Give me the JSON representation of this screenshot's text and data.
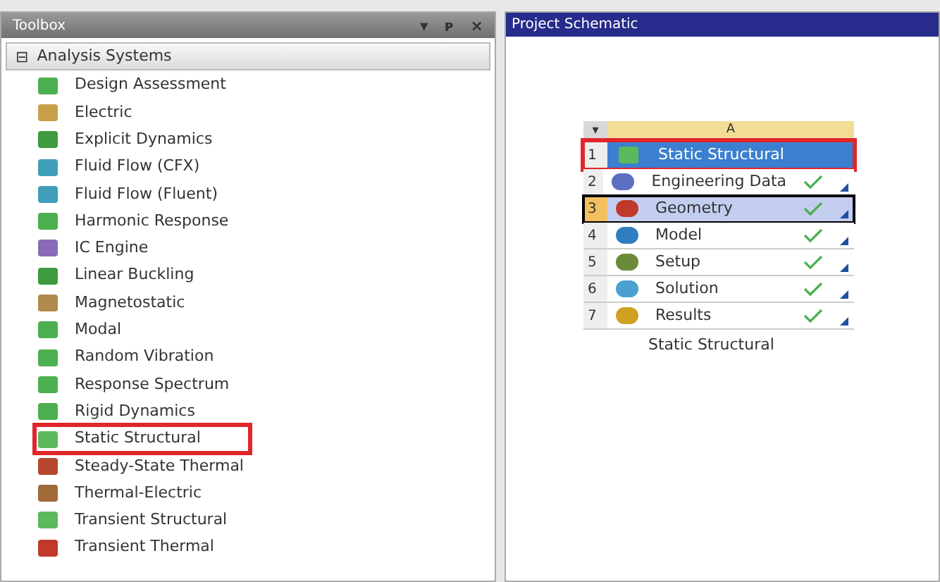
{
  "toolbox": {
    "title": "Toolbox",
    "controls": [
      "▾",
      "ᴘ",
      "×"
    ],
    "group": {
      "label": "Analysis Systems",
      "expanded": true,
      "toggle": "⊟"
    },
    "items": [
      {
        "label": "Design Assessment",
        "color": "#4caf50",
        "highlighted": false
      },
      {
        "label": "Electric",
        "color": "#c9a04a",
        "highlighted": false
      },
      {
        "label": "Explicit Dynamics",
        "color": "#3e9b3e",
        "highlighted": false
      },
      {
        "label": "Fluid Flow (CFX)",
        "color": "#3f9fb8",
        "highlighted": false
      },
      {
        "label": "Fluid Flow (Fluent)",
        "color": "#3f9fb8",
        "highlighted": false
      },
      {
        "label": "Harmonic Response",
        "color": "#4caf50",
        "highlighted": false
      },
      {
        "label": "IC Engine",
        "color": "#8a6bb8",
        "highlighted": false
      },
      {
        "label": "Linear Buckling",
        "color": "#3e9b3e",
        "highlighted": false
      },
      {
        "label": "Magnetostatic",
        "color": "#b08a4a",
        "highlighted": false
      },
      {
        "label": "Modal",
        "color": "#4caf50",
        "highlighted": false
      },
      {
        "label": "Random Vibration",
        "color": "#4caf50",
        "highlighted": false
      },
      {
        "label": "Response Spectrum",
        "color": "#4caf50",
        "highlighted": false
      },
      {
        "label": "Rigid Dynamics",
        "color": "#4caf50",
        "highlighted": false
      },
      {
        "label": "Static Structural",
        "color": "#5cb85c",
        "highlighted": true
      },
      {
        "label": "Steady-State Thermal",
        "color": "#b5482e",
        "highlighted": false
      },
      {
        "label": "Thermal-Electric",
        "color": "#a06a3a",
        "highlighted": false
      },
      {
        "label": "Transient Structural",
        "color": "#5cb85c",
        "highlighted": false
      },
      {
        "label": "Transient Thermal",
        "color": "#c0392b",
        "highlighted": false
      }
    ]
  },
  "schematic": {
    "title": "Project Schematic",
    "system": {
      "menu": "▾",
      "column": "A",
      "caption": "Static Structural",
      "header": {
        "number": "1",
        "label": "Static Structural",
        "color": "#5cb85c",
        "highlighted": true
      },
      "rows": [
        {
          "number": "2",
          "label": "Engineering Data",
          "color": "#5b6fc0",
          "selected": false,
          "checked": true
        },
        {
          "number": "3",
          "label": "Geometry",
          "color": "#c0392b",
          "selected": true,
          "checked": true
        },
        {
          "number": "4",
          "label": "Model",
          "color": "#2f7fc0",
          "selected": false,
          "checked": true
        },
        {
          "number": "5",
          "label": "Setup",
          "color": "#6a8a3a",
          "selected": false,
          "checked": true
        },
        {
          "number": "6",
          "label": "Solution",
          "color": "#4aa0d0",
          "selected": false,
          "checked": true
        },
        {
          "number": "7",
          "label": "Results",
          "color": "#d0a020",
          "selected": false,
          "checked": true
        }
      ]
    }
  }
}
